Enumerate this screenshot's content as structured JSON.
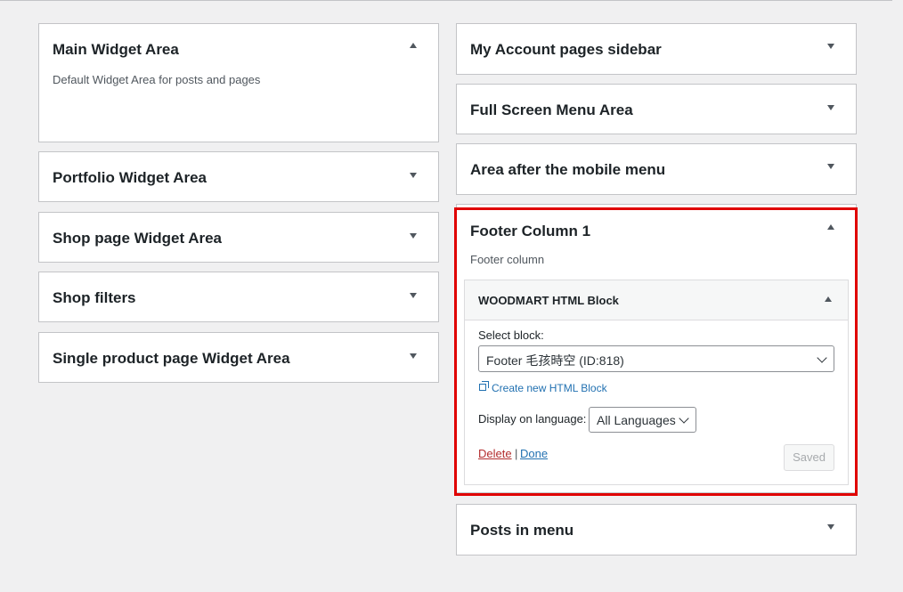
{
  "left_column": [
    {
      "title": "Main Widget Area",
      "description": "Default Widget Area for posts and pages",
      "expanded": true
    },
    {
      "title": "Portfolio Widget Area",
      "expanded": false
    },
    {
      "title": "Shop page Widget Area",
      "expanded": false
    },
    {
      "title": "Shop filters",
      "expanded": false
    },
    {
      "title": "Single product page Widget Area",
      "expanded": false
    }
  ],
  "right_column": [
    {
      "title": "My Account pages sidebar",
      "expanded": false
    },
    {
      "title": "Full Screen Menu Area",
      "expanded": false
    },
    {
      "title": "Area after the mobile menu",
      "expanded": false
    },
    {
      "title": "Footer Column 1",
      "description": "Footer column",
      "expanded": true
    },
    {
      "title": "Posts in menu",
      "expanded": false
    }
  ],
  "widget": {
    "title": "WOODMART HTML Block",
    "select_block_label": "Select block:",
    "select_block_value": "Footer 毛孩時空 (ID:818)",
    "create_link": "Create new HTML Block",
    "language_label": "Display on language:",
    "language_value": "All Languages",
    "delete_label": "Delete",
    "separator": "|",
    "done_label": "Done",
    "saved_label": "Saved"
  },
  "colors": {
    "highlight": "#e00000",
    "link": "#2271b1",
    "delete": "#b32d2e"
  }
}
